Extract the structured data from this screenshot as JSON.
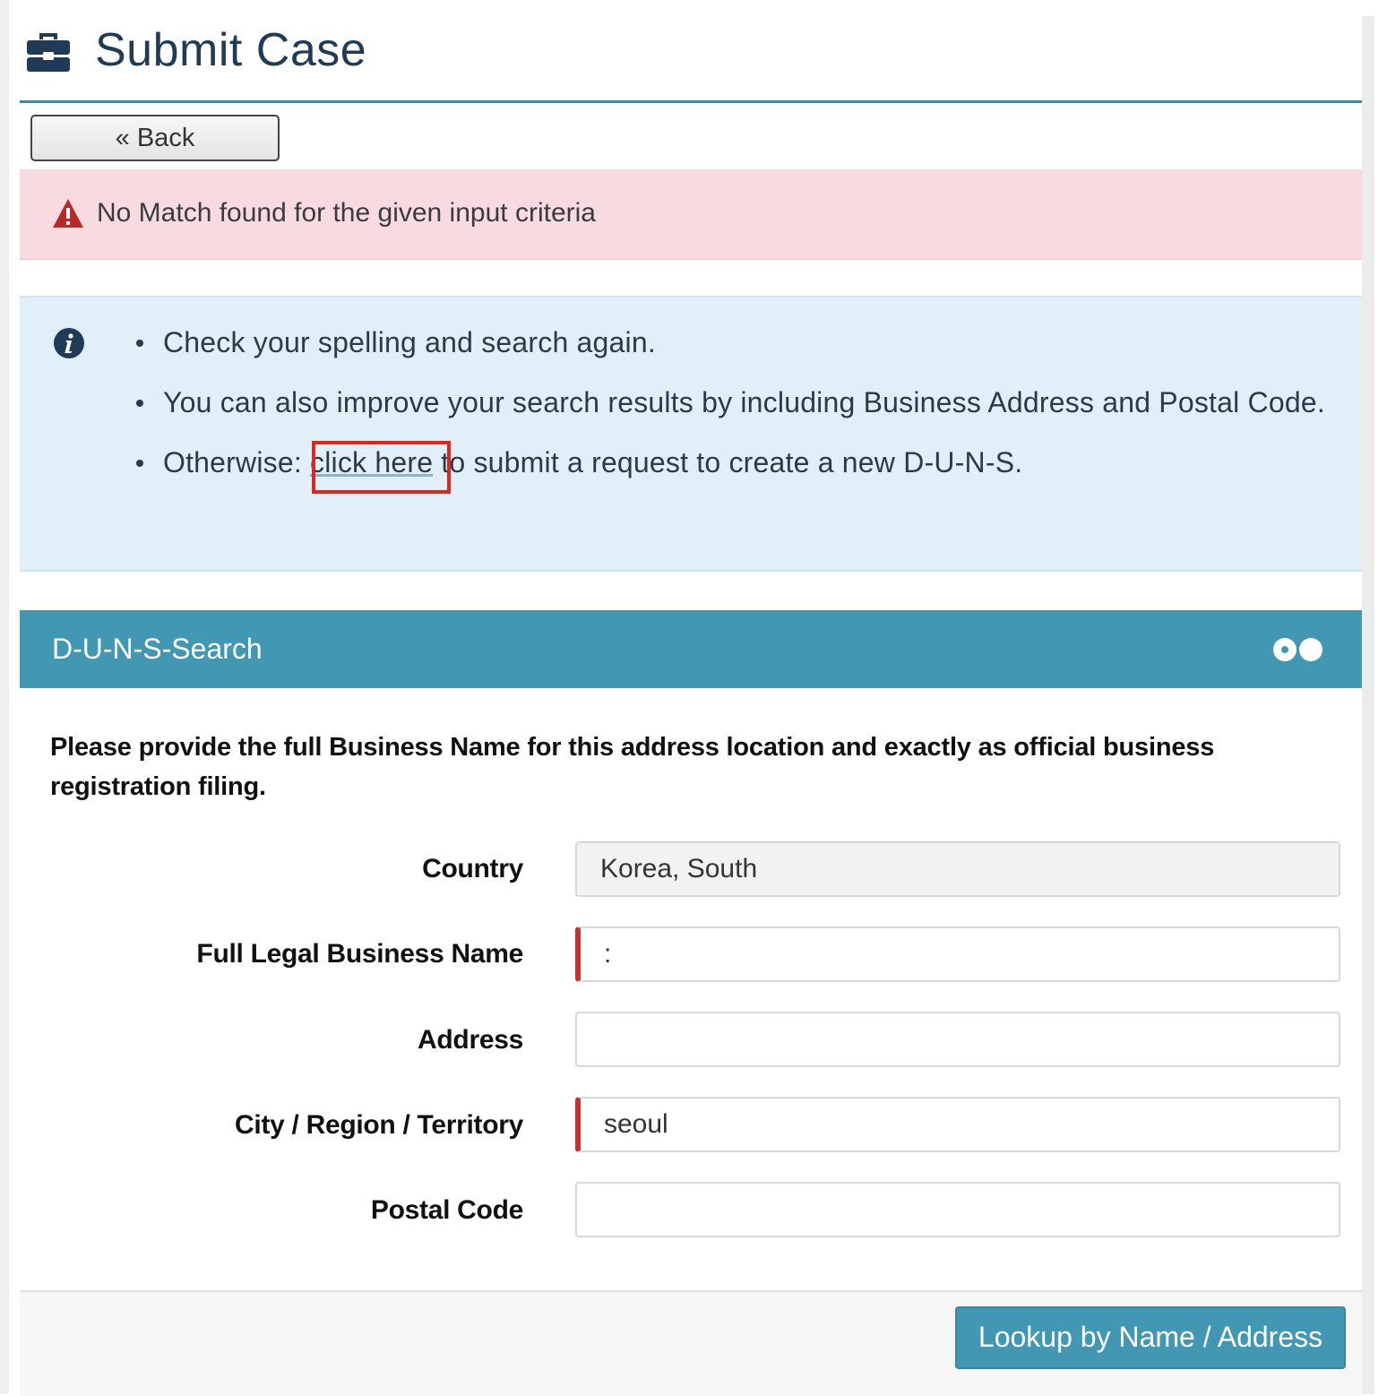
{
  "header": {
    "title": "Submit Case",
    "icon": "toolbox-icon"
  },
  "back_button": {
    "label": "« Back"
  },
  "error_alert": {
    "icon": "warning-icon",
    "message": "No Match found for the given input criteria"
  },
  "info_alert": {
    "icon": "info-icon",
    "items": [
      {
        "text": "Check your spelling and search again."
      },
      {
        "text": "You can also improve your search results by including Business Address and Postal Code."
      },
      {
        "prefix": "Otherwise: ",
        "link": "click here",
        "suffix": " to submit a request to create a new D-U-N-S."
      }
    ]
  },
  "panel": {
    "title": "D-U-N-S-Search",
    "toggle_icon": "toggle-icon",
    "instructions": "Please provide the full Business Name for this address location and exactly as official business registration filing.",
    "fields": {
      "country": {
        "label": "Country",
        "value": "Korea, South"
      },
      "business_name": {
        "label": "Full Legal Business Name",
        "value": ":"
      },
      "address": {
        "label": "Address",
        "value": ""
      },
      "city": {
        "label": "City / Region / Territory",
        "value": "seoul"
      },
      "postal": {
        "label": "Postal Code",
        "value": ""
      }
    },
    "lookup_button": "Lookup by Name / Address"
  },
  "colors": {
    "accent": "#4297b2",
    "title": "#1f3b57",
    "error_bg": "#f8dbe0",
    "info_bg": "#e1f0f8",
    "required": "#c9302c",
    "highlight": "#e0251f"
  }
}
